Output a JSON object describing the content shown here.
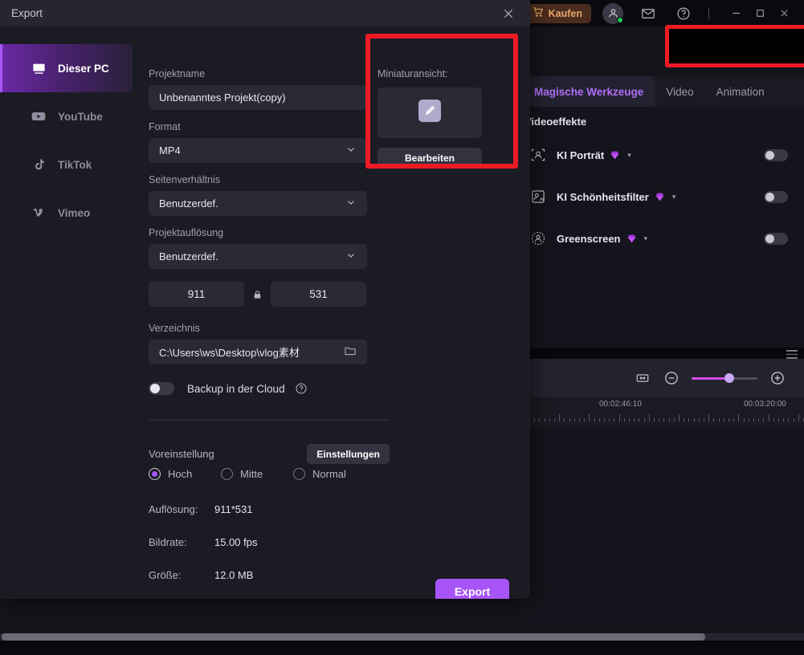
{
  "app": {
    "titlebar": {
      "buy_label": "Kaufen",
      "icons": [
        "cart-icon",
        "account-icon",
        "mail-icon",
        "help-icon"
      ],
      "window_controls": [
        "minimize",
        "maximize",
        "close"
      ]
    },
    "export_button": {
      "label": "Export",
      "icon": "upload-icon"
    },
    "right_panel": {
      "tabs": [
        {
          "label": "Magische Werkzeuge",
          "active": true
        },
        {
          "label": "Video",
          "active": false
        },
        {
          "label": "Animation",
          "active": false
        }
      ],
      "section_title": "Videoeffekte",
      "effects": [
        {
          "label": "KI Porträt",
          "icon": "ai-portrait-icon",
          "badge": "gem",
          "enabled": false
        },
        {
          "label": "KI Schönheitsfilter",
          "icon": "ai-beauty-icon",
          "badge": "gem",
          "enabled": false
        },
        {
          "label": "Greenscreen",
          "icon": "greenscreen-icon",
          "badge": "gem",
          "enabled": false
        }
      ]
    },
    "timeline": {
      "fit_icon": "fit-to-width-icon",
      "zoom_out_icon": "zoom-out-icon",
      "zoom_in_icon": "zoom-in-icon",
      "zoom_value_percent": 57,
      "ruler_labels": [
        "00:02:46:10",
        "00:03:20:00"
      ]
    }
  },
  "dialog": {
    "title": "Export",
    "close_icon": "close-icon",
    "sidebar": [
      {
        "label": "Dieser PC",
        "icon": "monitor-icon",
        "active": true
      },
      {
        "label": "YouTube",
        "icon": "youtube-icon",
        "active": false
      },
      {
        "label": "TikTok",
        "icon": "tiktok-icon",
        "active": false
      },
      {
        "label": "Vimeo",
        "icon": "vimeo-icon",
        "active": false
      }
    ],
    "fields": {
      "project_name_label": "Projektname",
      "project_name_value": "Unbenanntes Projekt(copy)",
      "format_label": "Format",
      "format_value": "MP4",
      "aspect_label": "Seitenverhältnis",
      "aspect_value": "Benutzerdef.",
      "resolution_label": "Projektauflösung",
      "resolution_value": "Benutzerdef.",
      "width_value": "911",
      "height_value": "531",
      "lock_icon": "lock-icon",
      "directory_label": "Verzeichnis",
      "directory_value": "C:\\Users\\ws\\Desktop\\vlog素材",
      "folder_icon": "folder-icon",
      "cloud_backup_label": "Backup in der Cloud",
      "cloud_backup_enabled": false,
      "help_icon": "question-mark-icon"
    },
    "thumbnail": {
      "label": "Miniaturansicht:",
      "edit_button": "Bearbeiten",
      "preview_icon": "pencil-edit-icon"
    },
    "preset": {
      "label": "Voreinstellung",
      "settings_button": "Einstellungen",
      "options": [
        {
          "label": "Hoch",
          "selected": true
        },
        {
          "label": "Mitte",
          "selected": false
        },
        {
          "label": "Normal",
          "selected": false
        }
      ]
    },
    "info": [
      {
        "key": "Auflösung:",
        "value": "911*531"
      },
      {
        "key": "Bildrate:",
        "value": "15.00 fps"
      },
      {
        "key": "Größe:",
        "value": "12.0 MB"
      }
    ],
    "export_button": "Export"
  },
  "colors": {
    "accent_purple": "#a855f7",
    "highlight_red": "#ee1b24",
    "buy_orange": "#e8a56a",
    "dialog_bg": "#1b1b24"
  }
}
